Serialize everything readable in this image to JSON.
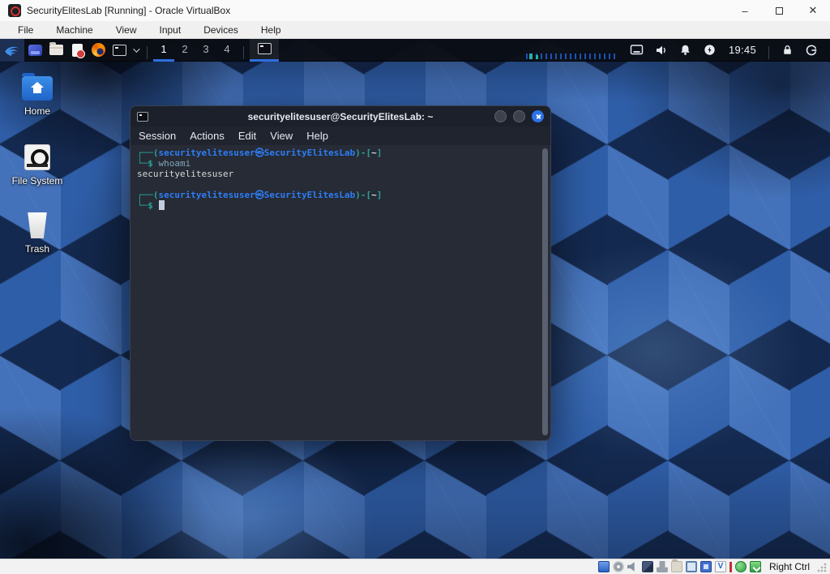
{
  "colors": {
    "prompt_teal": "#2aa198",
    "prompt_blue": "#2e7df6",
    "command_text": "#82a6ba",
    "output_text": "#d8d8d8",
    "workspace_underline": "#2f6fe0",
    "terminal_close_button": "#2d73e8",
    "panel_bg": "#0b0e14",
    "terminal_bg": "#262b35",
    "wallpaper_base": "#2f5ea8"
  },
  "window": {
    "title": "SecurityElitesLab [Running] - Oracle VirtualBox",
    "controls": {
      "minimize": "–",
      "close": "✕"
    },
    "menu": [
      "File",
      "Machine",
      "View",
      "Input",
      "Devices",
      "Help"
    ]
  },
  "panel": {
    "launchers": [
      "kali-menu-icon",
      "show-desktop-icon",
      "file-manager-icon",
      "text-editor-icon",
      "firefox-icon",
      "terminal-launcher-icon"
    ],
    "workspaces": [
      "1",
      "2",
      "3",
      "4"
    ],
    "active_workspace": "1",
    "taskbar": [
      {
        "icon": "terminal-window-icon",
        "active": true
      }
    ],
    "tray_icons": [
      "activity-graph",
      "display-icon",
      "volume-icon",
      "notifications-icon",
      "power-icon"
    ],
    "clock": "19:45",
    "session_icons": [
      "lock-icon",
      "logout-icon"
    ]
  },
  "desktop": {
    "icons": [
      {
        "label": "Home",
        "icon": "home-folder-icon"
      },
      {
        "label": "File System",
        "icon": "file-system-icon"
      },
      {
        "label": "Trash",
        "icon": "trash-icon"
      }
    ]
  },
  "terminal": {
    "title": "securityelitesuser@SecurityElitesLab: ~",
    "menu": [
      "Session",
      "Actions",
      "Edit",
      "View",
      "Help"
    ],
    "prompt": {
      "frame_open": "┌──(",
      "user_host": "securityelitesuser㉿SecurityElitesLab",
      "frame_mid": ")-[",
      "path": "~",
      "frame_close": "]",
      "prompt_line2": "└─$"
    },
    "command": "whoami",
    "output": "securityelitesuser"
  },
  "statusbar": {
    "icons": [
      "hard-disks-icon",
      "optical-drives-icon",
      "audio-icon",
      "network-icon",
      "usb-icon",
      "shared-folders-icon",
      "display-icon",
      "recording-icon",
      "features-icon",
      "mouse-integration-icon",
      "keyboard-icon"
    ],
    "host_key": "Right Ctrl"
  }
}
